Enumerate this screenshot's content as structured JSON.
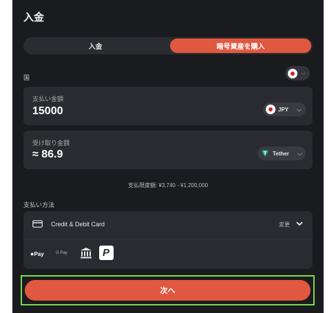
{
  "header": {
    "title": "入金"
  },
  "tabs": [
    {
      "label": "入金",
      "active": false
    },
    {
      "label": "暗号資産を購入",
      "active": true
    }
  ],
  "country": {
    "label": "国",
    "flag_icon": "japan-flag-icon"
  },
  "pay_amount": {
    "label": "支払い金額",
    "value": "15000",
    "currency": "JPY"
  },
  "receive_amount": {
    "label": "受け取り金額",
    "value": "≈ 86.9",
    "currency": "Tether"
  },
  "limit_text": "支払限度額: ¥3,740 - ¥1,200,000",
  "payment": {
    "section_label": "支払い方法",
    "method": "Credit & Debit Card",
    "change_label": "変更",
    "apple_pay": "Pay",
    "google_pay": "G Pay"
  },
  "next_button": "次へ",
  "colors": {
    "accent": "#e0583f",
    "panel": "#1a1b1f",
    "card": "#2a2b30",
    "highlight": "#7bdc4e",
    "tether": "#26a17b"
  }
}
